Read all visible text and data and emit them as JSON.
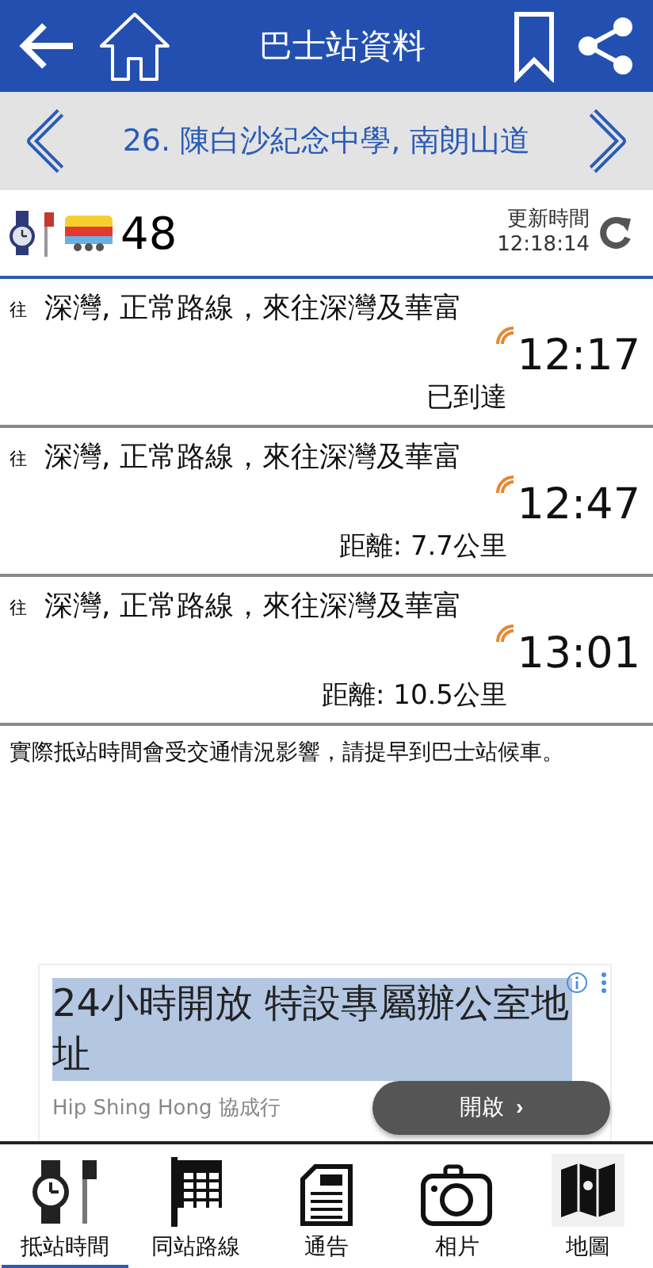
{
  "header": {
    "title": "巴士站資料"
  },
  "stop": {
    "name": "26. 陳白沙紀念中學, 南朗山道"
  },
  "route": {
    "number": "48",
    "update_label": "更新時間",
    "update_time": "12:18:14"
  },
  "arrivals": [
    {
      "prefix": "往",
      "destination": "深灣, 正常路線，來往深灣及華富",
      "time": "12:17",
      "status": "已到達"
    },
    {
      "prefix": "往",
      "destination": "深灣, 正常路線，來往深灣及華富",
      "time": "12:47",
      "status": "距離: 7.7公里"
    },
    {
      "prefix": "往",
      "destination": "深灣, 正常路線，來往深灣及華富",
      "time": "13:01",
      "status": "距離: 10.5公里"
    }
  ],
  "notice": "實際抵站時間會受交通情況影響，請提早到巴士站候車。",
  "ad": {
    "title": "24小時開放 特設專屬辦公室地址",
    "advertiser": "Hip Shing Hong 協成行",
    "button": "開啟",
    "chevron": "›"
  },
  "tabs": [
    {
      "label": "抵站時間",
      "kind": "eta",
      "selected": true
    },
    {
      "label": "同站路線",
      "kind": "routes",
      "selected": false
    },
    {
      "label": "通告",
      "kind": "notice",
      "selected": false
    },
    {
      "label": "相片",
      "kind": "photo",
      "selected": false
    },
    {
      "label": "地圖",
      "kind": "map",
      "selected": false
    }
  ]
}
